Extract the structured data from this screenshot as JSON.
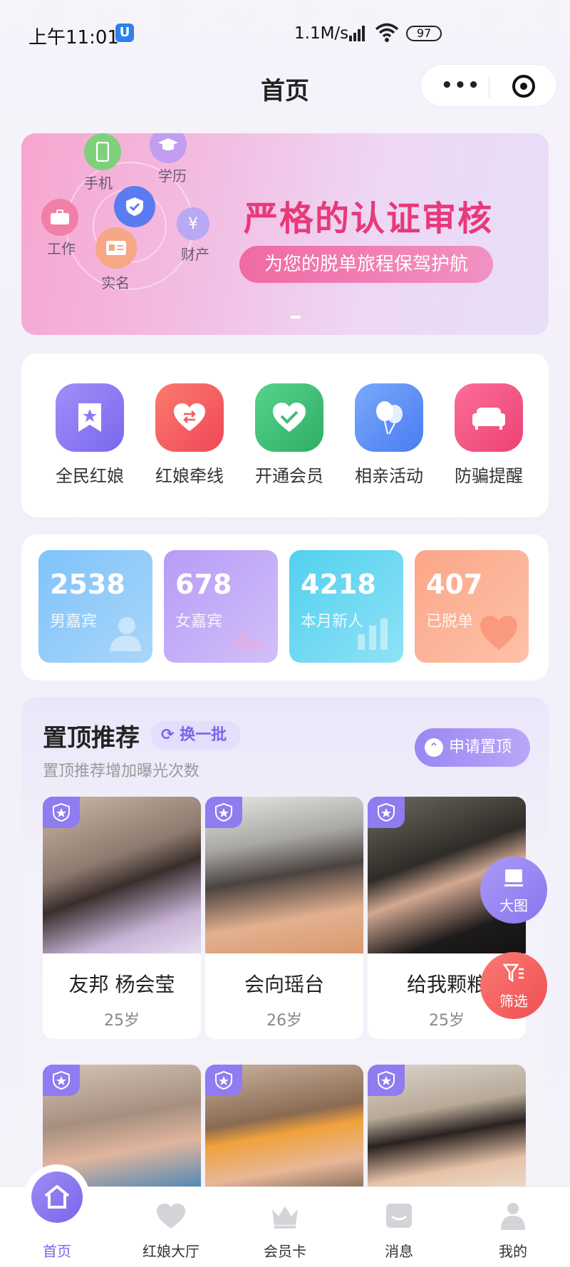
{
  "status_bar": {
    "time": "上午11:01",
    "net_speed": "1.1M/s",
    "battery": "97"
  },
  "nav": {
    "title": "首页"
  },
  "banner": {
    "headline": "严格的认证审核",
    "tagline": "为您的脱单旅程保驾护航",
    "badges": [
      "手机",
      "学历",
      "工作",
      "财产",
      "实名"
    ]
  },
  "menu": [
    {
      "label": "全民红娘",
      "icon": "star-bookmark-icon",
      "color": "#8b7cf4"
    },
    {
      "label": "红娘牵线",
      "icon": "heart-exchange-icon",
      "color": "#f25a5f"
    },
    {
      "label": "开通会员",
      "icon": "heart-icon",
      "color": "#3cbd76"
    },
    {
      "label": "相亲活动",
      "icon": "balloons-icon",
      "color": "#5b8ff5"
    },
    {
      "label": "防骗提醒",
      "icon": "sofa-icon",
      "color": "#f25b84"
    }
  ],
  "stats": [
    {
      "value": "2538",
      "label": "男嘉宾"
    },
    {
      "value": "678",
      "label": "女嘉宾"
    },
    {
      "value": "4218",
      "label": "本月新人"
    },
    {
      "value": "407",
      "label": "已脱单"
    }
  ],
  "recommend": {
    "title": "置顶推荐",
    "swap_label": "换一批",
    "subtitle": "置顶推荐增加曝光次数",
    "apply_label": "申请置顶",
    "profiles": [
      {
        "name": "友邦 杨会莹",
        "age": "25岁"
      },
      {
        "name": "会向瑶台",
        "age": "26岁"
      },
      {
        "name": "给我颗粮",
        "age": "25岁"
      },
      {
        "name": "",
        "age": ""
      },
      {
        "name": "",
        "age": ""
      },
      {
        "name": "",
        "age": ""
      }
    ]
  },
  "fabs": {
    "big_view": "大图",
    "filter": "筛选"
  },
  "tabbar": [
    {
      "label": "首页",
      "icon": "home-icon"
    },
    {
      "label": "红娘大厅",
      "icon": "heart-icon"
    },
    {
      "label": "会员卡",
      "icon": "crown-icon"
    },
    {
      "label": "消息",
      "icon": "message-icon"
    },
    {
      "label": "我的",
      "icon": "user-icon"
    }
  ]
}
